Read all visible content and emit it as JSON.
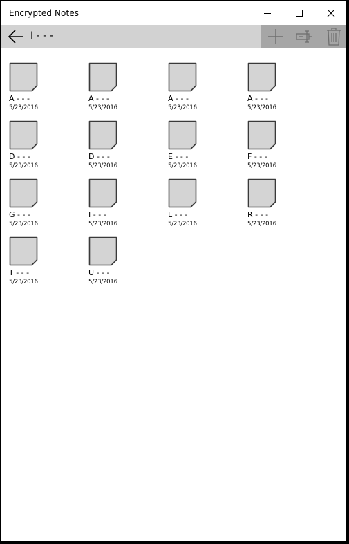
{
  "window": {
    "title": "Encrypted Notes"
  },
  "command_bar": {
    "folder_title": "I - - -",
    "actions": [
      "add-icon",
      "rename-icon",
      "delete-icon"
    ]
  },
  "notes": [
    {
      "name": "A - - -",
      "date": "5/23/2016"
    },
    {
      "name": "A - - -",
      "date": "5/23/2016"
    },
    {
      "name": "A - - -",
      "date": "5/23/2016"
    },
    {
      "name": "A - - -",
      "date": "5/23/2016"
    },
    {
      "name": "D - - -",
      "date": "5/23/2016"
    },
    {
      "name": "D - - -",
      "date": "5/23/2016"
    },
    {
      "name": "E - - -",
      "date": "5/23/2016"
    },
    {
      "name": "F - - -",
      "date": "5/23/2016"
    },
    {
      "name": "G - - -",
      "date": "5/23/2016"
    },
    {
      "name": "I - - -",
      "date": "5/23/2016"
    },
    {
      "name": "L - - -",
      "date": "5/23/2016"
    },
    {
      "name": "R - - -",
      "date": "5/23/2016"
    },
    {
      "name": "T - - -",
      "date": "5/23/2016"
    },
    {
      "name": "U - - -",
      "date": "5/23/2016"
    }
  ],
  "colors": {
    "command_bar": "#d2d2d2",
    "action_group": "#a6a6a6",
    "note_fill": "#d4d4d4",
    "note_stroke": "#3a3a3a",
    "disabled_icon": "#6e6e6e"
  }
}
